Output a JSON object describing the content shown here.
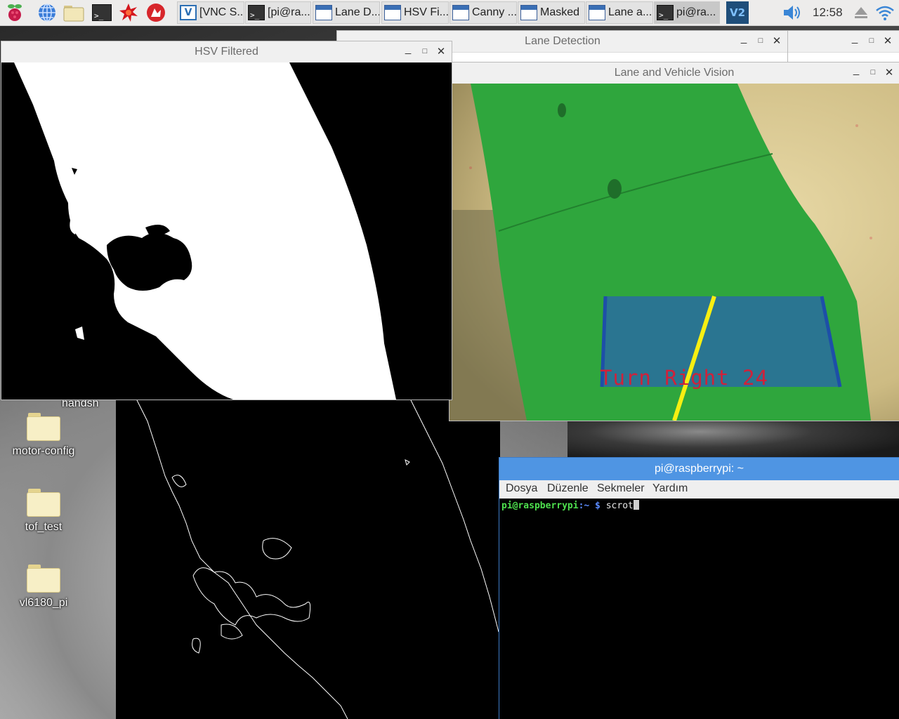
{
  "taskbar": {
    "launchers": [
      {
        "icon": "raspberry-menu-icon"
      },
      {
        "icon": "web-browser-icon"
      },
      {
        "icon": "file-manager-icon"
      },
      {
        "icon": "terminal-icon"
      },
      {
        "icon": "burst-app-icon"
      },
      {
        "icon": "wolfram-icon"
      }
    ],
    "buttons": [
      {
        "label": "[VNC S...",
        "icon": "vnc-icon"
      },
      {
        "label": "[pi@ra...",
        "icon": "terminal-icon"
      },
      {
        "label": "Lane D...",
        "icon": "window-icon"
      },
      {
        "label": "HSV Fi...",
        "icon": "window-icon"
      },
      {
        "label": "Canny ...",
        "icon": "window-icon"
      },
      {
        "label": "Masked",
        "icon": "window-icon"
      },
      {
        "label": "Lane a...",
        "icon": "window-icon"
      },
      {
        "label": "pi@ra...",
        "icon": "terminal-icon"
      }
    ],
    "tray": {
      "vnc": "vnc-server-icon",
      "volume": "volume-icon",
      "eject": "eject-icon",
      "wifi": "wifi-icon"
    },
    "clock": "12:58"
  },
  "desktop": {
    "items": [
      {
        "label": "handsh"
      },
      {
        "label": "motor-config"
      },
      {
        "label": "tof_test"
      },
      {
        "label": "vl6180_pi"
      }
    ]
  },
  "windows": {
    "lane_detection": {
      "title": "Lane Detection"
    },
    "hsv_filtered": {
      "title": "HSV Filtered"
    },
    "lane_vehicle": {
      "title": "Lane and Vehicle Vision",
      "overlay_text": "Turn Right 24"
    },
    "terminal": {
      "title": "pi@raspberrypi: ~",
      "menu": [
        "Dosya",
        "Düzenle",
        "Sekmeler",
        "Yardım"
      ],
      "prompt_user": "pi@raspberrypi",
      "prompt_path": ":~ $",
      "command": "scrot"
    }
  },
  "colors": {
    "terminal_title": "#4f95e3",
    "lane_green": "#2aa33a",
    "overlay_red": "#d0213a",
    "lane_yellow": "#f7ef12",
    "lane_blue": "#1d4fa8"
  }
}
